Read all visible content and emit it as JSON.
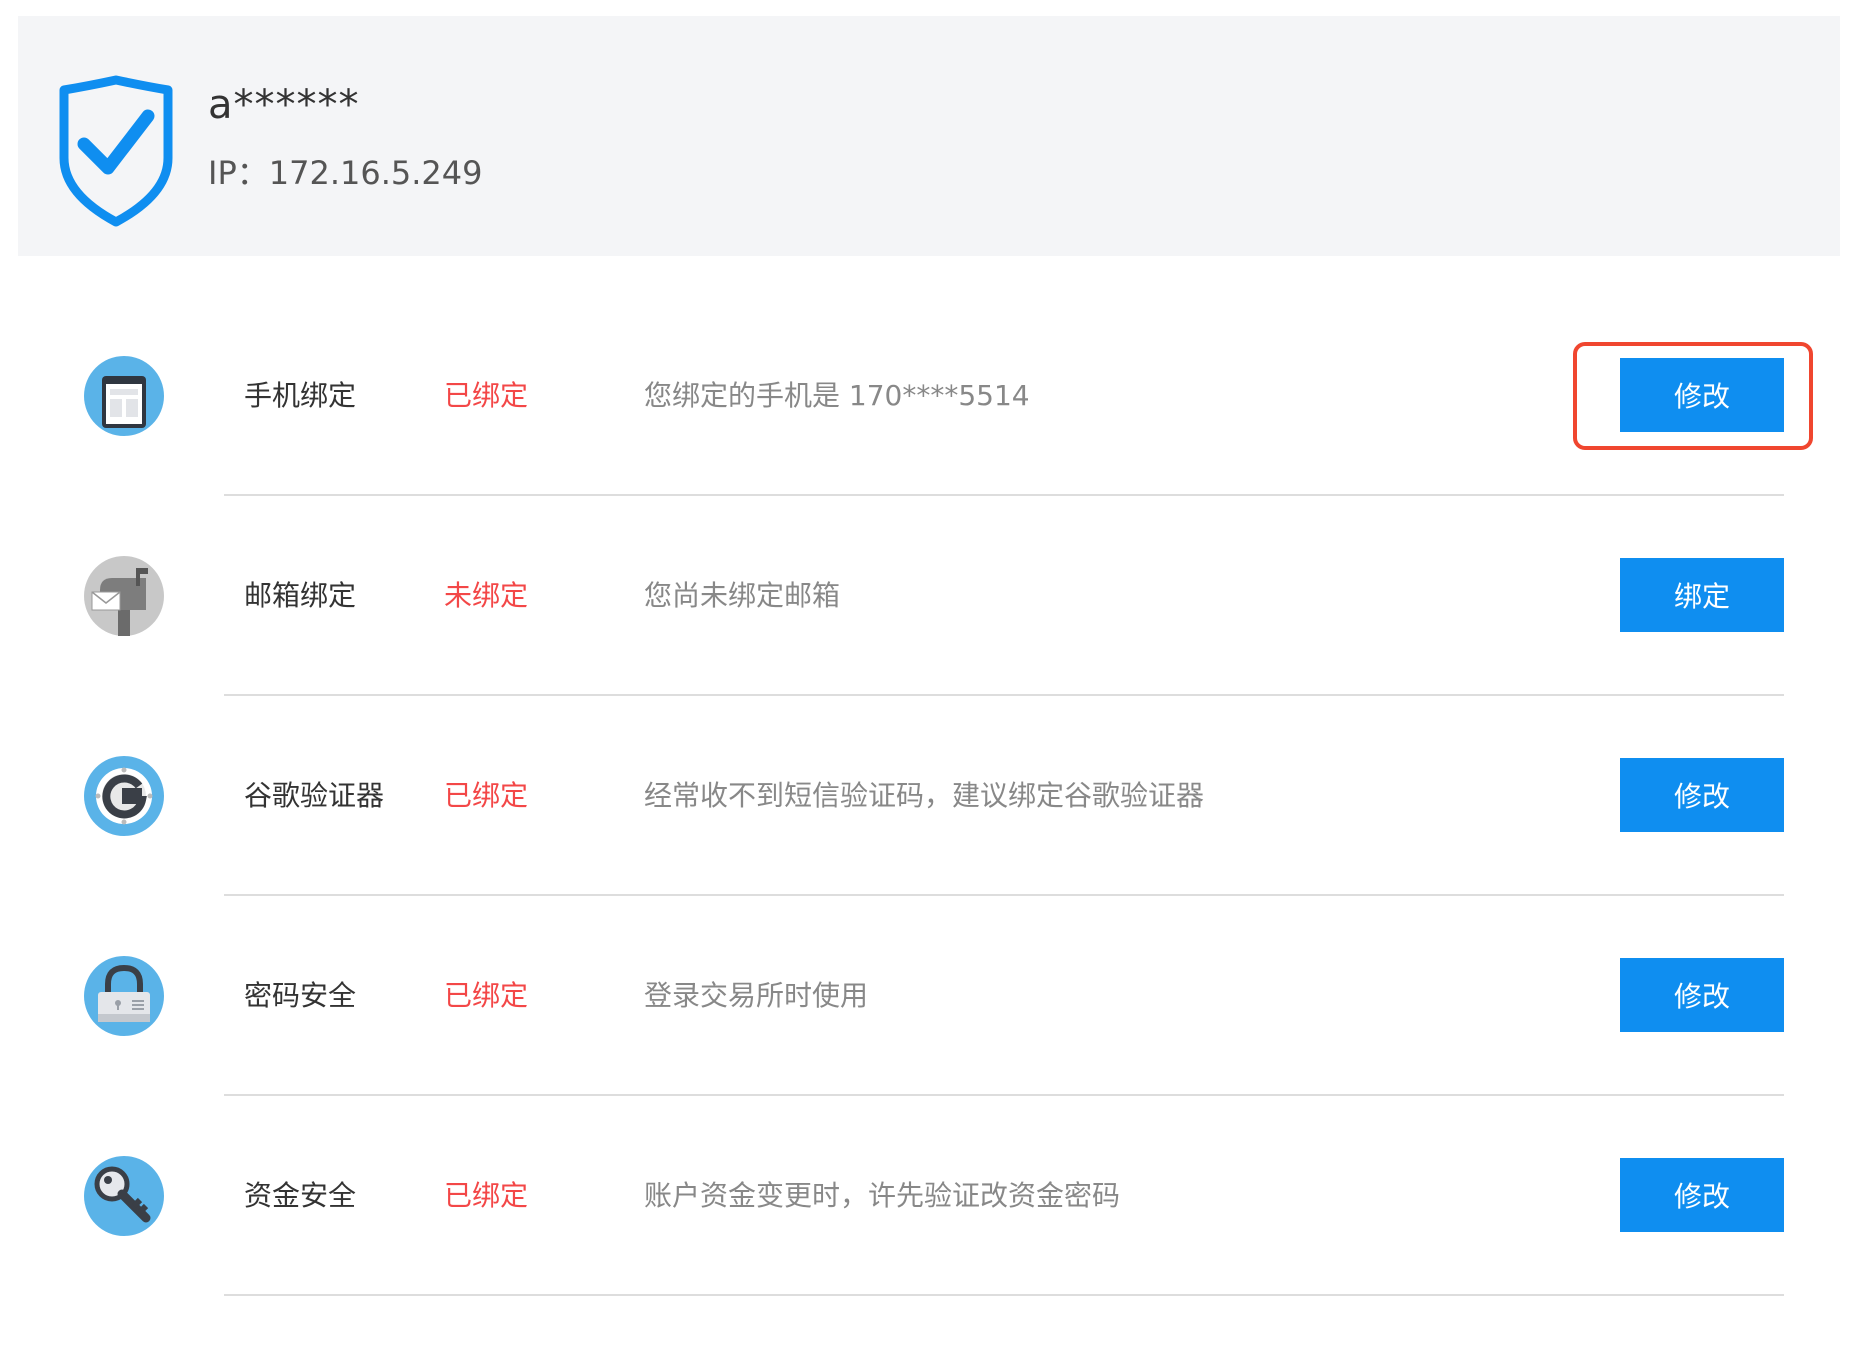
{
  "account": {
    "username": "a******",
    "ip": "IP：172.16.5.249"
  },
  "colors": {
    "accent": "#0f8ef0",
    "status_red": "#f34747",
    "icon_circle": "#5ab3e8"
  },
  "security_items": [
    {
      "icon": "phone-icon",
      "title": "手机绑定",
      "status": "已绑定",
      "description": "您绑定的手机是 170****5514",
      "button": "修改"
    },
    {
      "icon": "mailbox-icon",
      "title": "邮箱绑定",
      "status": "未绑定",
      "description": "您尚未绑定邮箱",
      "button": "绑定"
    },
    {
      "icon": "google-authenticator-icon",
      "title": "谷歌验证器",
      "status": "已绑定",
      "description": "经常收不到短信验证码，建议绑定谷歌验证器",
      "button": "修改"
    },
    {
      "icon": "padlock-icon",
      "title": "密码安全",
      "status": "已绑定",
      "description": "登录交易所时使用",
      "button": "修改"
    },
    {
      "icon": "key-icon",
      "title": "资金安全",
      "status": "已绑定",
      "description": "账户资金变更时，许先验证改资金密码",
      "button": "修改"
    }
  ]
}
